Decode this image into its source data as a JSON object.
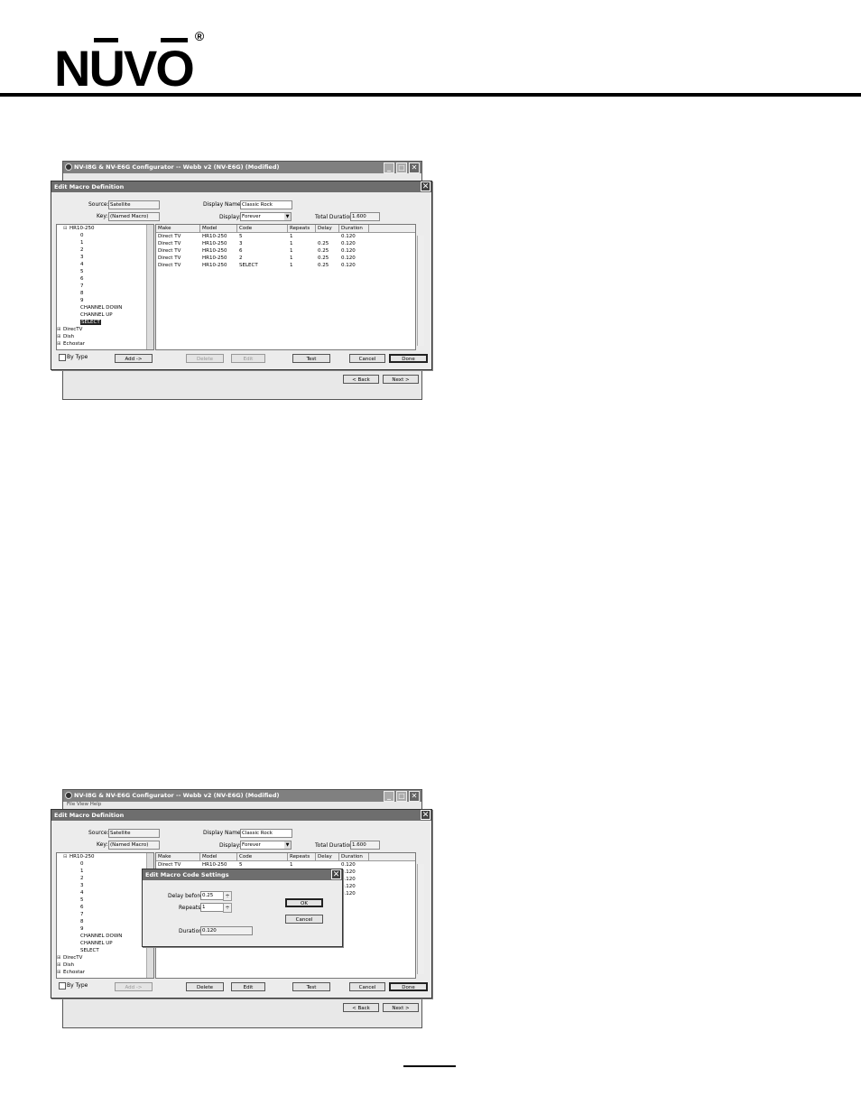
{
  "header": {
    "logo_left": "N",
    "logo_u": "U",
    "logo_v": "V",
    "logo_o": "O",
    "logo_reg": "®"
  },
  "colors": {
    "rule": "#000000",
    "titlebar": "#6e6e6e"
  },
  "screens": [
    {
      "outer_title": "NV-I8G & NV-E6G Configurator -- Webb v2 (NV-E6G) (Modified)",
      "menu": "",
      "dialog_title": "Edit Macro Definition",
      "source_label": "Source:",
      "source_value": "Satellite",
      "key_label": "Key:",
      "key_value": "(Named Macro)",
      "display_name_label": "Display Name:",
      "display_name_value": "Classic Rock",
      "display_label": "Display:",
      "display_value": "Forever",
      "total_duration_label": "Total Duration:",
      "total_duration_value": "1.600",
      "tree": [
        "HR10-250",
        "0",
        "1",
        "2",
        "3",
        "4",
        "5",
        "6",
        "7",
        "8",
        "9",
        "CHANNEL DOWN",
        "CHANNEL UP",
        "SELECT",
        "DirecTV",
        "Dish",
        "Echostar"
      ],
      "columns": [
        "Make",
        "Model",
        "Code",
        "Repeats",
        "Delay",
        "Duration"
      ],
      "rows": [
        [
          "Direct TV",
          "HR10-250",
          "5",
          "1",
          "",
          "0.120"
        ],
        [
          "Direct TV",
          "HR10-250",
          "3",
          "1",
          "0.25",
          "0.120"
        ],
        [
          "Direct TV",
          "HR10-250",
          "6",
          "1",
          "0.25",
          "0.120"
        ],
        [
          "Direct TV",
          "HR10-250",
          "2",
          "1",
          "0.25",
          "0.120"
        ],
        [
          "Direct TV",
          "HR10-250",
          "SELECT",
          "1",
          "0.25",
          "0.120"
        ]
      ],
      "by_type": "By Type",
      "buttons": {
        "add": "Add ->",
        "delete": "Delete",
        "edit": "Edit",
        "test": "Test",
        "cancel": "Cancel",
        "done": "Done"
      },
      "nav": {
        "back": "< Back",
        "next": "Next >"
      }
    },
    {
      "outer_title": "NV-I8G & NV-E6G Configurator -- Webb v2 (NV-E6G) (Modified)",
      "menu": "File  View  Help",
      "dialog_title": "Edit Macro Definition",
      "source_label": "Source:",
      "source_value": "Satellite",
      "key_label": "Key:",
      "key_value": "(Named Macro)",
      "display_name_label": "Display Name:",
      "display_name_value": "Classic Rock",
      "display_label": "Display:",
      "display_value": "Forever",
      "total_duration_label": "Total Duration:",
      "total_duration_value": "1.600",
      "tree": [
        "HR10-250",
        "0",
        "1",
        "2",
        "3",
        "4",
        "5",
        "6",
        "7",
        "8",
        "9",
        "CHANNEL DOWN",
        "CHANNEL UP",
        "SELECT",
        "DirecTV",
        "Dish",
        "Echostar"
      ],
      "columns": [
        "Make",
        "Model",
        "Code",
        "Repeats",
        "Delay",
        "Duration"
      ],
      "rows": [
        [
          "Direct TV",
          "HR10-250",
          "5",
          "1",
          "",
          "0.120"
        ],
        [
          "",
          "",
          "",
          "",
          "",
          "0.120"
        ],
        [
          "",
          "",
          "",
          "",
          "",
          "0.120"
        ],
        [
          "",
          "",
          "",
          "",
          "",
          "0.120"
        ],
        [
          "",
          "",
          "",
          "",
          "",
          "0.120"
        ]
      ],
      "by_type": "By Type",
      "buttons": {
        "add": "Add ->",
        "delete": "Delete",
        "edit": "Edit",
        "test": "Test",
        "cancel": "Cancel",
        "done": "Done"
      },
      "nav": {
        "back": "< Back",
        "next": "Next >"
      },
      "subdialog": {
        "title": "Edit Macro Code Settings",
        "delay_label": "Delay before",
        "delay_value": "0.25",
        "repeats_label": "Repeats",
        "repeats_value": "1",
        "duration_label": "Duration",
        "duration_value": "0.120",
        "ok": "OK",
        "cancel": "Cancel"
      }
    }
  ]
}
